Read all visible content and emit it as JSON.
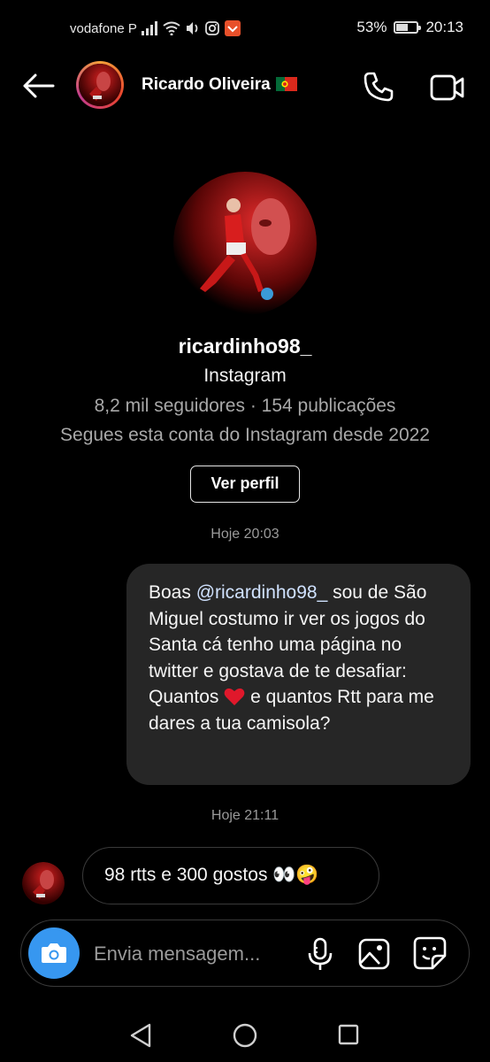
{
  "status_bar": {
    "carrier": "vodafone P",
    "battery_percent": "53%",
    "battery_level": 0.53,
    "time": "20:13",
    "icons": [
      "signal-icon",
      "wifi-icon",
      "volume-icon",
      "instagram-notification-icon",
      "app-notification-icon",
      "battery-icon"
    ]
  },
  "header": {
    "contact_name": "Ricardo Oliveira",
    "flag": "portugal-flag-icon",
    "icons": [
      "back-arrow-icon",
      "phone-icon",
      "video-camera-icon"
    ]
  },
  "profile": {
    "username": "ricardinho98_",
    "platform": "Instagram",
    "stats": "8,2 mil seguidores · 154 publicações",
    "follow_since": "Segues esta conta do Instagram desde 2022",
    "view_profile_label": "Ver perfil"
  },
  "messages": [
    {
      "timestamp": "Hoje 20:03",
      "sender": "me",
      "text_before_mention": "Boas ",
      "mention": "@ricardinho98_",
      "text_after_mention": " sou de São Miguel costumo ir ver os jogos do Santa cá tenho uma página no twitter e gostava de te desafiar:",
      "text_line2_before_heart": "Quantos ",
      "heart": "red-heart-emoji",
      "text_line2_after_heart": " e quantos Rtt para me dares a tua camisola?"
    },
    {
      "timestamp": "Hoje 21:11",
      "sender": "them",
      "text": "98 rtts e 300 gostos 👀🤪"
    }
  ],
  "composer": {
    "placeholder": "Envia mensagem...",
    "icons": [
      "camera-icon",
      "microphone-icon",
      "gallery-icon",
      "sticker-icon"
    ]
  },
  "nav_bar": {
    "icons": [
      "nav-back-icon",
      "nav-home-icon",
      "nav-recents-icon"
    ]
  },
  "colors": {
    "background": "#000000",
    "bubble_sent": "#262626",
    "accent_blue": "#3797f0",
    "secondary_text": "#a8a8a8"
  }
}
